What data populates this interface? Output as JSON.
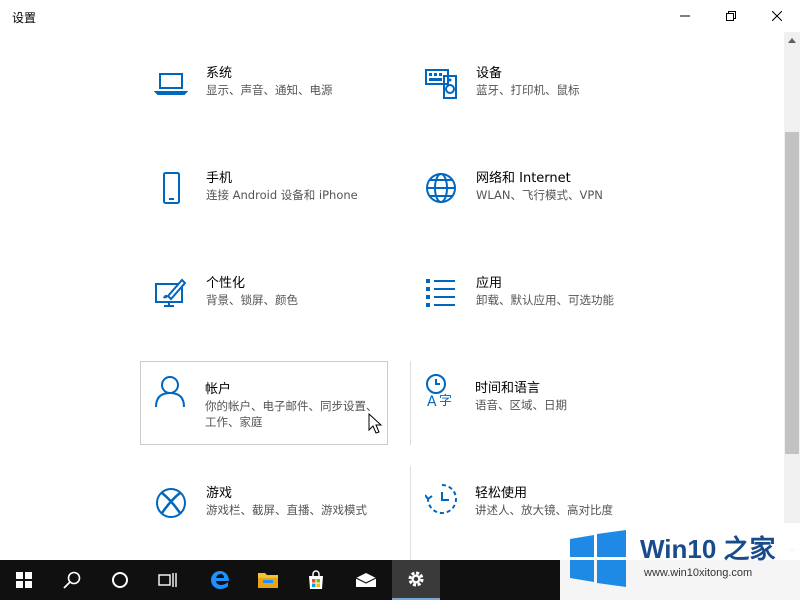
{
  "window": {
    "title": "设置"
  },
  "tiles": [
    {
      "label": "系统",
      "desc": "显示、声音、通知、电源",
      "icon": "laptop-icon"
    },
    {
      "label": "设备",
      "desc": "蓝牙、打印机、鼠标",
      "icon": "keyboard-speaker-icon"
    },
    {
      "label": "手机",
      "desc": "连接 Android 设备和 iPhone",
      "icon": "phone-icon"
    },
    {
      "label": "网络和 Internet",
      "desc": "WLAN、飞行模式、VPN",
      "icon": "globe-icon"
    },
    {
      "label": "个性化",
      "desc": "背景、锁屏、颜色",
      "icon": "paint-monitor-icon"
    },
    {
      "label": "应用",
      "desc": "卸载、默认应用、可选功能",
      "icon": "list-icon"
    },
    {
      "label": "帐户",
      "desc": "你的帐户、电子邮件、同步设置、工作、家庭",
      "icon": "person-icon"
    },
    {
      "label": "时间和语言",
      "desc": "语音、区域、日期",
      "icon": "time-language-icon"
    },
    {
      "label": "游戏",
      "desc": "游戏栏、截屏、直播、游戏模式",
      "icon": "xbox-icon"
    },
    {
      "label": "轻松使用",
      "desc": "讲述人、放大镜、高对比度",
      "icon": "ease-of-access-icon"
    }
  ],
  "taskbar": {
    "items": [
      "start-icon",
      "search-icon",
      "cortana-icon",
      "task-view-icon",
      "edge-icon",
      "file-explorer-icon",
      "store-icon",
      "mail-icon",
      "settings-gear-icon"
    ]
  },
  "watermark": {
    "title": "Win10 之家",
    "url": "www.win10xitong.com"
  },
  "colors": {
    "accent": "#0067c0",
    "taskbar": "#101010",
    "watermark_blue": "#1a4c8c"
  }
}
